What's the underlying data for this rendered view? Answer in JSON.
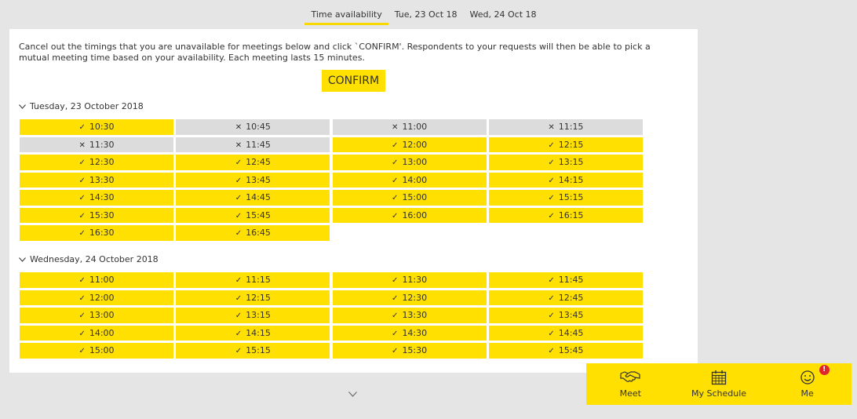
{
  "tabs": [
    {
      "label": "Time availability"
    },
    {
      "label": "Tue, 23 Oct 18"
    },
    {
      "label": "Wed, 24 Oct 18"
    }
  ],
  "intro_text": "Cancel out the timings that you are unavailable for meetings below and click `CONFIRM'. Respondents to your requests will then be able to pick a mutual meeting time based on your availability. Each meeting lasts 15 minutes.",
  "confirm_label": "CONFIRM",
  "days": [
    {
      "title": "Tuesday, 23 October 2018",
      "slots": [
        {
          "time": "10:30",
          "available": true
        },
        {
          "time": "10:45",
          "available": false
        },
        {
          "time": "11:00",
          "available": false
        },
        {
          "time": "11:15",
          "available": false
        },
        {
          "time": "11:30",
          "available": false
        },
        {
          "time": "11:45",
          "available": false
        },
        {
          "time": "12:00",
          "available": true
        },
        {
          "time": "12:15",
          "available": true
        },
        {
          "time": "12:30",
          "available": true
        },
        {
          "time": "12:45",
          "available": true
        },
        {
          "time": "13:00",
          "available": true
        },
        {
          "time": "13:15",
          "available": true
        },
        {
          "time": "13:30",
          "available": true
        },
        {
          "time": "13:45",
          "available": true
        },
        {
          "time": "14:00",
          "available": true
        },
        {
          "time": "14:15",
          "available": true
        },
        {
          "time": "14:30",
          "available": true
        },
        {
          "time": "14:45",
          "available": true
        },
        {
          "time": "15:00",
          "available": true
        },
        {
          "time": "15:15",
          "available": true
        },
        {
          "time": "15:30",
          "available": true
        },
        {
          "time": "15:45",
          "available": true
        },
        {
          "time": "16:00",
          "available": true
        },
        {
          "time": "16:15",
          "available": true
        },
        {
          "time": "16:30",
          "available": true
        },
        {
          "time": "16:45",
          "available": true
        }
      ]
    },
    {
      "title": "Wednesday, 24 October 2018",
      "slots": [
        {
          "time": "11:00",
          "available": true
        },
        {
          "time": "11:15",
          "available": true
        },
        {
          "time": "11:30",
          "available": true
        },
        {
          "time": "11:45",
          "available": true
        },
        {
          "time": "12:00",
          "available": true
        },
        {
          "time": "12:15",
          "available": true
        },
        {
          "time": "12:30",
          "available": true
        },
        {
          "time": "12:45",
          "available": true
        },
        {
          "time": "13:00",
          "available": true
        },
        {
          "time": "13:15",
          "available": true
        },
        {
          "time": "13:30",
          "available": true
        },
        {
          "time": "13:45",
          "available": true
        },
        {
          "time": "14:00",
          "available": true
        },
        {
          "time": "14:15",
          "available": true
        },
        {
          "time": "14:30",
          "available": true
        },
        {
          "time": "14:45",
          "available": true
        },
        {
          "time": "15:00",
          "available": true
        },
        {
          "time": "15:15",
          "available": true
        },
        {
          "time": "15:30",
          "available": true
        },
        {
          "time": "15:45",
          "available": true
        }
      ]
    }
  ],
  "bottom_nav": {
    "meet": {
      "label": "Meet",
      "icon": "handshake-icon"
    },
    "schedule": {
      "label": "My Schedule",
      "icon": "calendar-icon"
    },
    "me": {
      "label": "Me",
      "icon": "smiley-icon",
      "badge": "!"
    }
  },
  "colors": {
    "accent": "#ffe000",
    "unavailable": "#dcdcdc",
    "background": "#e5e5e5",
    "badge": "#e0262c"
  }
}
